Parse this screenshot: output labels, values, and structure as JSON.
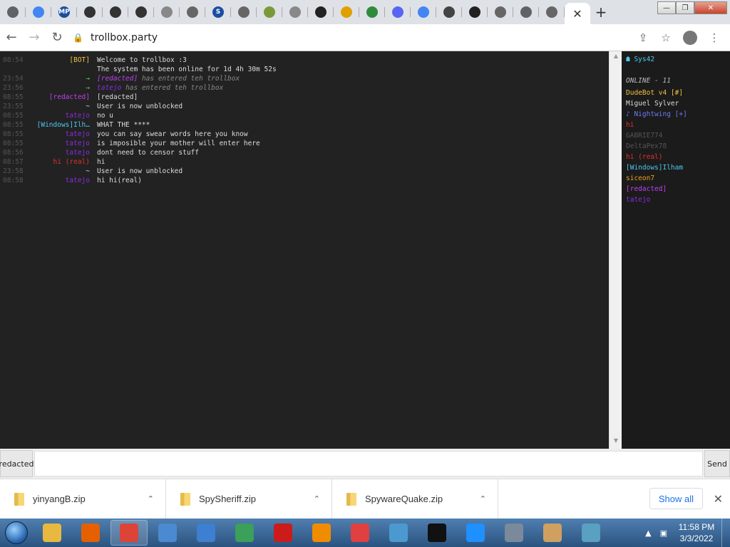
{
  "browser": {
    "tabs": [
      {
        "icon": "chrome-icon",
        "color": "#5f6368"
      },
      {
        "icon": "google-icon",
        "color": "#4285f4"
      },
      {
        "icon": "mp-icon",
        "color": "#1a4f9e",
        "label": "MP"
      },
      {
        "icon": "bank-icon",
        "color": "#333333"
      },
      {
        "icon": "bank-icon",
        "color": "#333333"
      },
      {
        "icon": "bank-icon",
        "color": "#333333"
      },
      {
        "icon": "globe-icon",
        "color": "#888888"
      },
      {
        "icon": "globe-icon",
        "color": "#666666"
      },
      {
        "icon": "s-icon",
        "color": "#1b4ea0",
        "label": "S"
      },
      {
        "icon": "globe-icon",
        "color": "#666666"
      },
      {
        "icon": "seal-icon",
        "color": "#7a9a3a"
      },
      {
        "icon": "app-icon",
        "color": "#888888"
      },
      {
        "icon": "github-icon",
        "color": "#222222"
      },
      {
        "icon": "triangle-icon",
        "color": "#e0a000"
      },
      {
        "icon": "sheet-icon",
        "color": "#2e8b3a"
      },
      {
        "icon": "discord-icon",
        "color": "#5865f2"
      },
      {
        "icon": "google-icon",
        "color": "#4285f4"
      },
      {
        "icon": "gear-icon",
        "color": "#444444"
      },
      {
        "icon": "github-icon",
        "color": "#222222"
      },
      {
        "icon": "globe-icon",
        "color": "#666666"
      },
      {
        "icon": "chrome-icon",
        "color": "#5f6368"
      },
      {
        "icon": "globe-icon",
        "color": "#666666"
      }
    ],
    "url": "trollbox.party"
  },
  "chat": {
    "messages": [
      {
        "time": "08:54",
        "nick": "[BOT]",
        "nick_color": "#f0c040",
        "text": "Welcome to trollbox :3",
        "system": false
      },
      {
        "time": "",
        "nick": "",
        "nick_color": "#dddddd",
        "text": "The system has been online for 1d 4h 30m 52s",
        "system": false
      },
      {
        "time": "23:54",
        "nick": "→",
        "nick_color": "#66cc66",
        "text_nick": "[redacted]",
        "text_nick_color": "#c040f0",
        "text": "has entered teh trollbox",
        "system": true
      },
      {
        "time": "23:56",
        "nick": "→",
        "nick_color": "#66cc66",
        "text_nick": "tatejo",
        "text_nick_color": "#8a2be2",
        "text": "has entered teh trollbox",
        "system": true
      },
      {
        "time": "08:55",
        "nick": "[redacted]",
        "nick_color": "#c040f0",
        "text": "[redacted]",
        "system": false
      },
      {
        "time": "23:55",
        "nick": "~",
        "nick_color": "#dddddd",
        "text": "User is now unblocked",
        "system": false
      },
      {
        "time": "08:55",
        "nick": "tatejo",
        "nick_color": "#8a2be2",
        "text": "no u",
        "system": false
      },
      {
        "time": "08:55",
        "nick": "[Windows]Ilh…",
        "nick_color": "#4dc8f0",
        "text": "WHAT THE ****",
        "system": false
      },
      {
        "time": "08:55",
        "nick": "tatejo",
        "nick_color": "#8a2be2",
        "text": "you can say swear words here you know",
        "system": false
      },
      {
        "time": "08:55",
        "nick": "tatejo",
        "nick_color": "#8a2be2",
        "text": "is imposible your mother will enter here",
        "system": false
      },
      {
        "time": "08:56",
        "nick": "tatejo",
        "nick_color": "#8a2be2",
        "text": "dont need to censor stuff",
        "system": false
      },
      {
        "time": "08:57",
        "nick": "hi (real)",
        "nick_color": "#e03030",
        "text": "hi",
        "system": false
      },
      {
        "time": "23:58",
        "nick": "~",
        "nick_color": "#dddddd",
        "text": "User is now unblocked",
        "system": false
      },
      {
        "time": "08:58",
        "nick": "tatejo",
        "nick_color": "#8a2be2",
        "text": "hi hi(real)",
        "system": false
      }
    ]
  },
  "sidebar": {
    "me": "☗ Sys42",
    "online_label": "ONLINE - 11",
    "users": [
      {
        "name": "DudeBot v4 [#]",
        "color": "#f0c040"
      },
      {
        "name": "Miguel Sylver",
        "color": "#dddddd"
      },
      {
        "name": "♪ Nightwing [+]",
        "color": "#6a7cf0"
      },
      {
        "name": "hi",
        "color": "#e03030"
      },
      {
        "name": "GABRIE774",
        "color": "#555555"
      },
      {
        "name": "DeltaPex78",
        "color": "#555555"
      },
      {
        "name": "hi (real)",
        "color": "#e03030"
      },
      {
        "name": "[Windows]Ilham",
        "color": "#4dc8f0"
      },
      {
        "name": "siceon7",
        "color": "#f0a020"
      },
      {
        "name": "[redacted]",
        "color": "#c040f0"
      },
      {
        "name": "tatejo",
        "color": "#8a2be2"
      }
    ]
  },
  "input": {
    "nick_label": "[redacted]",
    "value": "",
    "send_label": "Send"
  },
  "downloads": {
    "items": [
      {
        "name": "yinyangB.zip"
      },
      {
        "name": "SpySheriff.zip"
      },
      {
        "name": "SpywareQuake.zip"
      }
    ],
    "show_all_label": "Show all"
  },
  "taskbar": {
    "apps": [
      {
        "icon": "explorer-icon",
        "color": "#e8b840"
      },
      {
        "icon": "firefox-icon",
        "color": "#e66000"
      },
      {
        "icon": "chrome-icon",
        "color": "#db4437",
        "active": true
      },
      {
        "icon": "monitor-icon",
        "color": "#4a8ad0"
      },
      {
        "icon": "globe-icon",
        "color": "#3d7fd0"
      },
      {
        "icon": "shield-icon",
        "color": "#3aa05a"
      },
      {
        "icon": "opera-icon",
        "color": "#cc1b1b"
      },
      {
        "icon": "avast-icon",
        "color": "#f08c00"
      },
      {
        "icon": "no-icon",
        "color": "#e04040"
      },
      {
        "icon": "control-panel-icon",
        "color": "#4a9ad0"
      },
      {
        "icon": "cmd-icon",
        "color": "#111111"
      },
      {
        "icon": "ie-icon",
        "color": "#1e90ff"
      },
      {
        "icon": "calculator-icon",
        "color": "#7a8a9a"
      },
      {
        "icon": "paint-icon",
        "color": "#d0a060"
      },
      {
        "icon": "cubes-icon",
        "color": "#5aa0c0"
      }
    ],
    "time": "11:58 PM",
    "date": "3/3/2022"
  }
}
